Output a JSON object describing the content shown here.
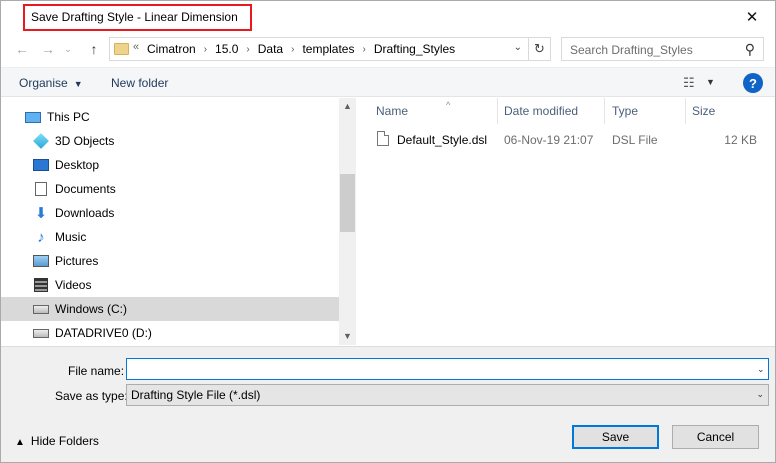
{
  "window": {
    "title": "Save Drafting Style - Linear Dimension",
    "close_glyph": "✕"
  },
  "address": {
    "overflow": "«",
    "crumbs": [
      "Cimatron",
      "15.0",
      "Data",
      "templates",
      "Drafting_Styles"
    ],
    "search_placeholder": "Search Drafting_Styles"
  },
  "toolbar": {
    "organise": "Organise",
    "new_folder": "New folder"
  },
  "nav": {
    "items": [
      {
        "label": "This PC",
        "icon": "computer-icon"
      },
      {
        "label": "3D Objects",
        "icon": "3d-objects-icon"
      },
      {
        "label": "Desktop",
        "icon": "desktop-icon"
      },
      {
        "label": "Documents",
        "icon": "documents-icon"
      },
      {
        "label": "Downloads",
        "icon": "downloads-icon"
      },
      {
        "label": "Music",
        "icon": "music-icon"
      },
      {
        "label": "Pictures",
        "icon": "pictures-icon"
      },
      {
        "label": "Videos",
        "icon": "videos-icon"
      },
      {
        "label": "Windows (C:)",
        "icon": "drive-icon",
        "selected": true
      },
      {
        "label": "DATADRIVE0 (D:)",
        "icon": "drive-icon"
      }
    ]
  },
  "columns": {
    "name": "Name",
    "date": "Date modified",
    "type": "Type",
    "size": "Size"
  },
  "files": [
    {
      "name": "Default_Style.dsl",
      "date": "06-Nov-19 21:07",
      "type": "DSL File",
      "size": "12 KB"
    }
  ],
  "form": {
    "file_name_label": "File name:",
    "file_name_value": "",
    "save_type_label": "Save as type:",
    "save_type_value": "Drafting Style File (*.dsl)"
  },
  "footer": {
    "hide_folders": "Hide Folders",
    "save": "Save",
    "cancel": "Cancel"
  }
}
